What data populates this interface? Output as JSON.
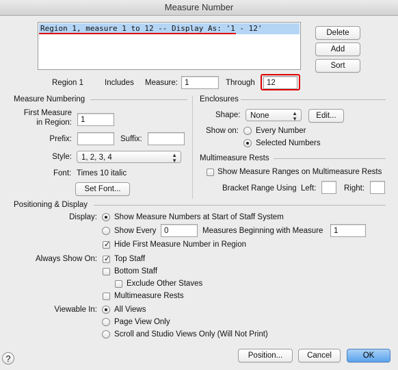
{
  "window": {
    "title": "Measure Number"
  },
  "regions": {
    "items": [
      "Region   1, measure    1 to   12 -- Display As: '1 - 12'"
    ],
    "delete_label": "Delete",
    "add_label": "Add",
    "sort_label": "Sort"
  },
  "range": {
    "region_label": "Region 1",
    "includes_label": "Includes",
    "measure_label": "Measure:",
    "measure_value": "1",
    "through_label": "Through",
    "through_value": "12"
  },
  "numbering": {
    "section_title": "Measure Numbering",
    "first_measure_label_1": "First Measure",
    "first_measure_label_2": "in Region:",
    "first_measure_value": "1",
    "prefix_label": "Prefix:",
    "prefix_value": "",
    "suffix_label": "Suffix:",
    "suffix_value": "",
    "style_label": "Style:",
    "style_value": "1, 2, 3, 4",
    "font_label": "Font:",
    "font_value": "Times 10 italic",
    "set_font_label": "Set Font..."
  },
  "enclosures": {
    "section_title": "Enclosures",
    "shape_label": "Shape:",
    "shape_value": "None",
    "edit_label": "Edit...",
    "show_on_label": "Show on:",
    "every_number_label": "Every Number",
    "selected_numbers_label": "Selected Numbers",
    "show_on_selected": "Selected Numbers"
  },
  "multimeasure": {
    "section_title": "Multimeasure Rests",
    "show_ranges_label": "Show Measure Ranges on Multimeasure Rests",
    "show_ranges_checked": false,
    "bracket_range_label": "Bracket Range Using",
    "left_label": "Left:",
    "left_value": "",
    "right_label": "Right:",
    "right_value": ""
  },
  "positioning": {
    "section_title": "Positioning & Display",
    "display_label": "Display:",
    "show_at_start_label": "Show Measure Numbers at Start of Staff System",
    "show_every_label": "Show Every",
    "show_every_value": "0",
    "measures_beginning_label": "Measures Beginning with Measure",
    "beginning_value": "1",
    "display_selected": "Show Measure Numbers at Start of Staff System",
    "hide_first_label": "Hide First Measure Number in Region",
    "hide_first_checked": true,
    "always_show_label": "Always Show On:",
    "top_staff_label": "Top Staff",
    "top_staff_checked": true,
    "bottom_staff_label": "Bottom Staff",
    "bottom_staff_checked": false,
    "exclude_other_label": "Exclude Other Staves",
    "exclude_other_checked": false,
    "multimeasure_rests_label": "Multimeasure Rests",
    "multimeasure_rests_checked": false,
    "viewable_in_label": "Viewable In:",
    "all_views_label": "All Views",
    "page_view_label": "Page View Only",
    "scroll_studio_label": "Scroll and Studio Views Only (Will Not Print)",
    "viewable_selected": "All Views"
  },
  "footer": {
    "help_label": "?",
    "position_label": "Position...",
    "cancel_label": "Cancel",
    "ok_label": "OK"
  },
  "colors": {
    "selection": "#b5d5f5",
    "annotation_red": "#e00000",
    "default_button": "#5aa3ec"
  }
}
